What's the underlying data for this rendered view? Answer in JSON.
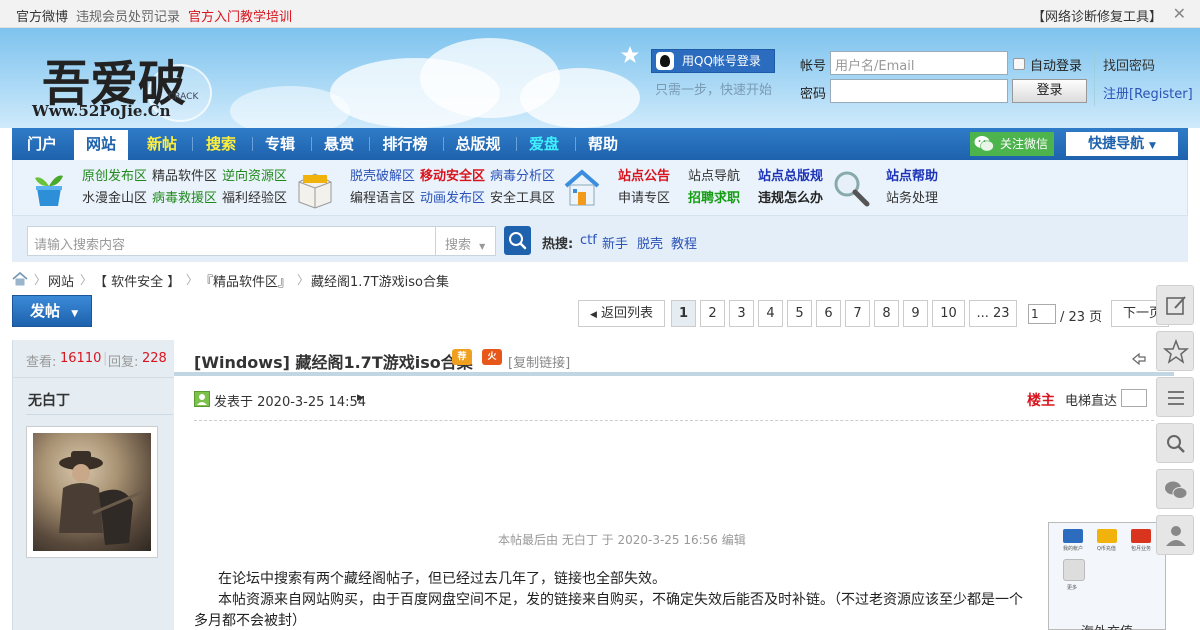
{
  "topbar": {
    "links": [
      "官方微博",
      "违规会员处罚记录",
      "官方入门教学培训"
    ],
    "right_link": "【网络诊断修复工具】",
    "close_glyph": "✕"
  },
  "header": {
    "logo_main": "吾爱破解",
    "logo_url": "Www.52PoJie.Cn",
    "logo_crack": "CRACK",
    "qq_login": "用QQ帐号登录",
    "qq_hint": "只需一步，快速开始",
    "account_label": "帐号",
    "account_placeholder": "用户名/Email",
    "auto_login": "自动登录",
    "password_label": "密码",
    "login_button": "登录",
    "forgot_password": "找回密码",
    "register": "注册[Register]"
  },
  "nav": {
    "items": [
      "门户",
      "网站",
      "新帖",
      "搜索",
      "专辑",
      "悬赏",
      "排行榜",
      "总版规",
      "爱盘",
      "帮助"
    ],
    "wechat": "关注微信",
    "quick_nav": "快捷导航"
  },
  "subnav": {
    "group1": [
      "原创发布区",
      "精品软件区",
      "逆向资源区",
      "水漫金山区",
      "病毒救援区",
      "福利经验区"
    ],
    "group2": [
      "脱壳破解区",
      "移动安全区",
      "病毒分析区",
      "编程语言区",
      "动画发布区",
      "安全工具区"
    ],
    "group3": [
      "站点公告",
      "站点导航",
      "站点总版规",
      "申请专区",
      "招聘求职",
      "违规怎么办"
    ],
    "group4": [
      "站点帮助",
      "站务处理"
    ]
  },
  "search": {
    "placeholder": "请输入搜索内容",
    "type": "搜索",
    "hot_label": "热搜:",
    "hot_items": [
      "ctf",
      "新手",
      "脱壳",
      "教程"
    ]
  },
  "breadcrumb": [
    "网站",
    "【 软件安全 】",
    "『精品软件区』",
    "藏经阁1.7T游戏iso合集"
  ],
  "toolbar": {
    "post_button": "发帖",
    "back_to_list": "返回列表",
    "pages": [
      "1",
      "2",
      "3",
      "4",
      "5",
      "6",
      "7",
      "8",
      "9",
      "10",
      "... 23"
    ],
    "page_input": "1",
    "page_total": "/ 23 页",
    "next": "下一页"
  },
  "thread": {
    "views_label": "查看:",
    "views": "16110",
    "replies_label": "回复:",
    "replies": "228",
    "title": "[Windows] 藏经阁1.7T游戏iso合集",
    "tag_recommend": "荐",
    "tag_hot": "火",
    "copy_link": "[复制链接]",
    "author": "无白丁",
    "posted": "发表于 2020-3-25 14:54",
    "floor": "楼主",
    "elevator": "电梯直达",
    "edited": "本帖最后由 无白丁 于 2020-3-25 16:56 编辑",
    "line1": "在论坛中搜索有两个藏经阁帖子，但已经过去几年了，链接也全部失效。",
    "line2": "本帖资源来自网站购买，由于百度网盘空间不足，发的链接来自购买，不确定失效后能否及时补链。（不过老资源应该至少都是一个",
    "line3": "多月都不会被封）"
  },
  "thumbnail": {
    "labels": [
      "我的帐户",
      "Q币充值",
      "包月业务",
      "更多"
    ],
    "caption": "海外充值"
  },
  "colors": {
    "nav_blue": "#1e62ad",
    "link_blue": "#2b53b8",
    "accent_red": "#d9141e",
    "green": "#21881e"
  }
}
